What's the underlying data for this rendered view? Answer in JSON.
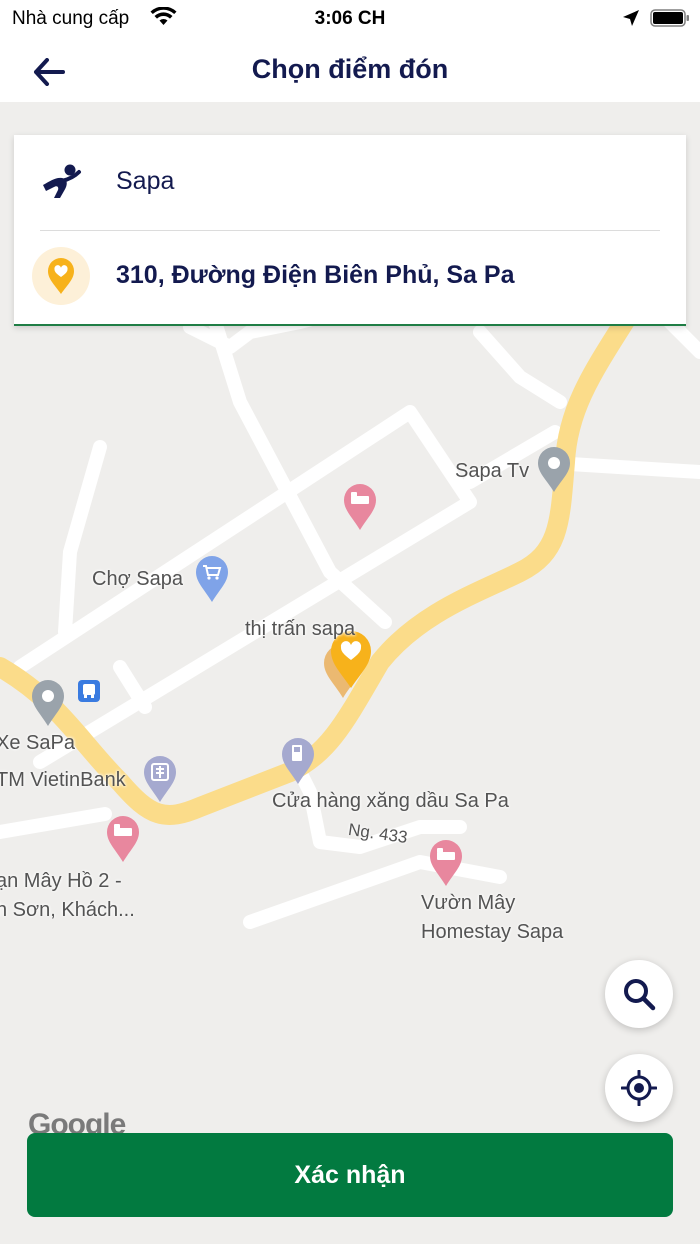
{
  "status_bar": {
    "carrier": "Nhà cung cấp",
    "time": "3:06 CH"
  },
  "header": {
    "title": "Chọn điểm đón"
  },
  "route_card": {
    "origin": "Sapa",
    "pickup_address": "310, Đường Điện Biên Phủ, Sa Pa"
  },
  "map": {
    "labels": {
      "sapa_tv": "Sapa Tv",
      "cho_sapa": "Chợ Sapa",
      "thi_tran_sapa": "thị trấn sapa",
      "xe_sapa": "Xe SaPa",
      "vietinbank": "TM VietinBank",
      "cua_hang_xang": "Cửa hàng xăng dầu Sa Pa",
      "ngo_433": "Ng. 433",
      "may_ho_line1": "ạn Mây Hồ 2 -",
      "may_ho_line2": "h Sơn, Khách...",
      "vuon_may_line1": "Vườn Mây",
      "vuon_may_line2": "Homestay Sapa",
      "google": "Google"
    },
    "colors": {
      "main_road": "#fbdc8a",
      "minor_road": "#ffffff",
      "background": "#efeeec",
      "hotel_pin": "#e8879e",
      "gray_pin": "#9aa3ab",
      "blue_pin": "#7fa3e8",
      "selected_pin": "#f7b21b"
    }
  },
  "actions": {
    "confirm_label": "Xác nhận"
  },
  "brand": {
    "primary_green": "#027a40",
    "navy": "#131a4f"
  }
}
